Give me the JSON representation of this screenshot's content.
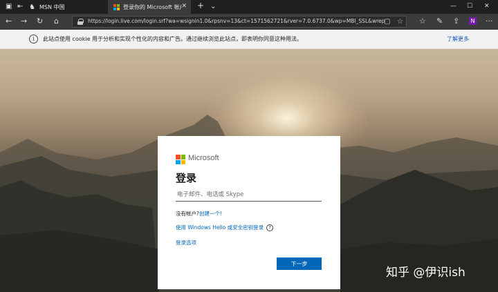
{
  "browser": {
    "tabs": [
      {
        "title": "MSN 中国",
        "active": false
      },
      {
        "title": "登录你的 Microsoft 帐户",
        "active": true
      }
    ],
    "url": "https://login.live.com/login.srf?wa=wsignin1.0&rpsnv=13&ct=1571562721&rver=7.0.6737.0&wp=MBI_SSL&wreply=https%3"
  },
  "cookie_bar": {
    "message": "此站点使用 cookie 用于分析和实现个性化的内容和广告。通过继续浏览此站点，即表明你同意这种用法。",
    "learn_more": "了解更多"
  },
  "login": {
    "brand": "Microsoft",
    "title": "登录",
    "email_placeholder": "电子邮件、电话或 Skype",
    "no_account_prefix": "没有帐户?",
    "create_link": "创建一个!",
    "windows_hello": "使用 Windows Hello 或安全密钥登录",
    "signin_options": "登录选项",
    "next_button": "下一步"
  },
  "colors": {
    "ms_red": "#f25022",
    "ms_green": "#7fba00",
    "ms_blue": "#00a4ef",
    "ms_yellow": "#ffb900",
    "primary": "#0067b8"
  },
  "watermark": "知乎 @伊识ish"
}
